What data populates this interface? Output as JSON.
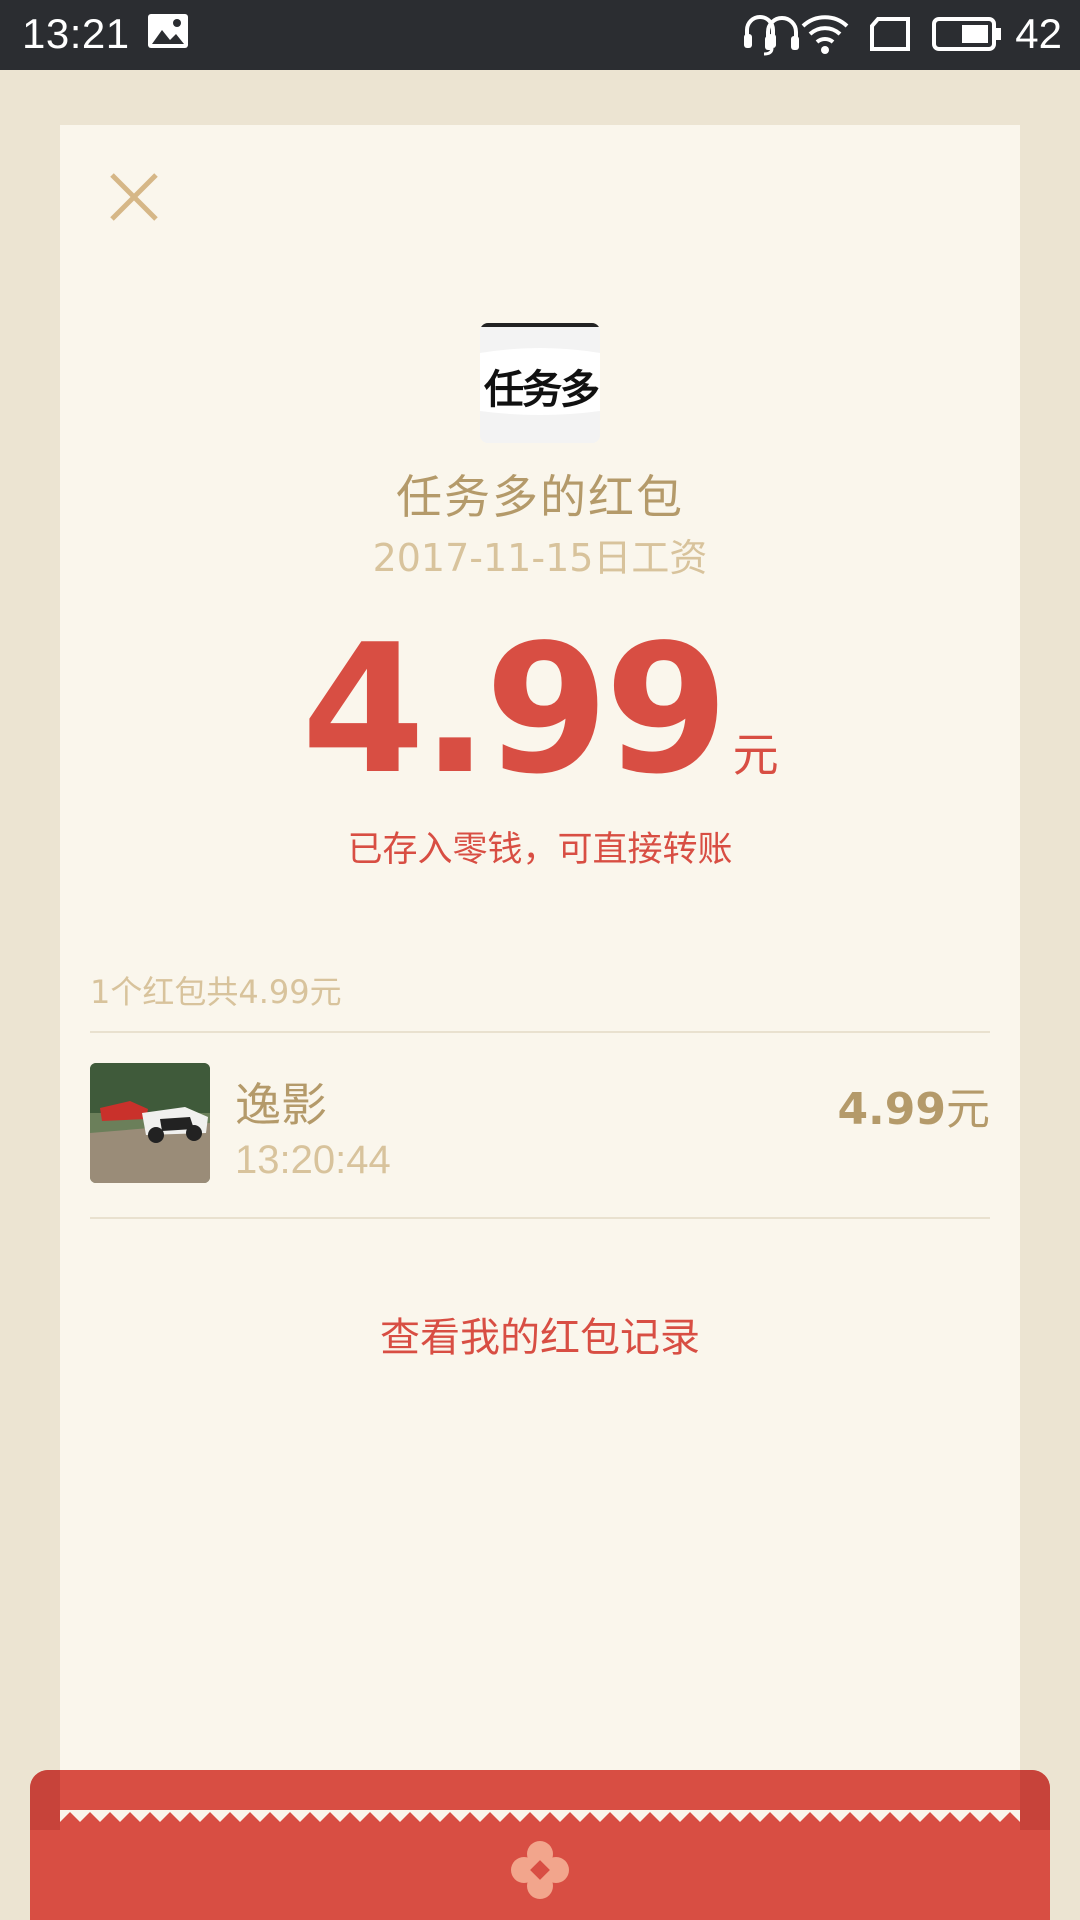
{
  "status_bar": {
    "time": "13:21",
    "icons": [
      "image-icon",
      "headset-icon",
      "wifi-icon",
      "screen-rotate-icon",
      "battery-icon"
    ],
    "battery_percent": "42"
  },
  "red_packet": {
    "sender_title": "任务多的红包",
    "memo": "2017-11-15日工资",
    "amount": "4.99",
    "unit": "元",
    "saved_note": "已存入零钱，可直接转账",
    "avatar_text": "任务多"
  },
  "records": {
    "summary": "1个红包共4.99元",
    "items": [
      {
        "name": "逸影",
        "time": "13:20:44",
        "amount": "4.99",
        "unit": "元"
      }
    ]
  },
  "history_link": "查看我的红包记录",
  "colors": {
    "accent_red": "#d84e43",
    "gold_text": "#b49a6a",
    "muted_text": "#d8c39c",
    "card_bg": "#faf6ec",
    "page_bg": "#ece4d2"
  }
}
